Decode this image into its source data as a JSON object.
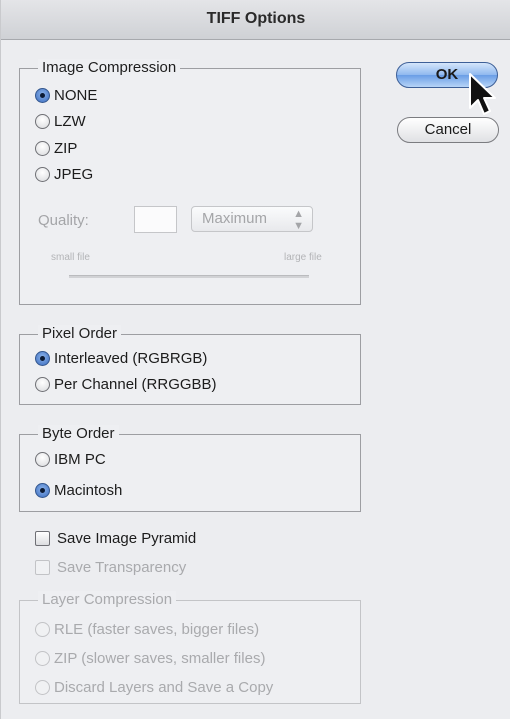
{
  "dialog": {
    "title": "TIFF Options"
  },
  "buttons": {
    "ok": "OK",
    "cancel": "Cancel"
  },
  "image_compression": {
    "label": "Image Compression",
    "options": [
      "NONE",
      "LZW",
      "ZIP",
      "JPEG"
    ],
    "selected": "NONE",
    "quality": {
      "label": "Quality:",
      "value": "",
      "select_value": "Maximum",
      "small_label": "small file",
      "large_label": "large file"
    }
  },
  "pixel_order": {
    "label": "Pixel Order",
    "options": [
      "Interleaved (RGBRGB)",
      "Per Channel (RRGGBB)"
    ],
    "selected": "Interleaved (RGBRGB)"
  },
  "byte_order": {
    "label": "Byte Order",
    "options": [
      "IBM PC",
      "Macintosh"
    ],
    "selected": "Macintosh"
  },
  "checkboxes": {
    "save_image_pyramid": {
      "label": "Save Image Pyramid",
      "checked": false
    },
    "save_transparency": {
      "label": "Save Transparency",
      "checked": false,
      "enabled": false
    }
  },
  "layer_compression": {
    "label": "Layer Compression",
    "enabled": false,
    "options": [
      "RLE (faster saves, bigger files)",
      "ZIP (slower saves, smaller files)",
      "Discard Layers and Save a Copy"
    ]
  },
  "colors": {
    "accent": "#3a6cc0",
    "dialog_bg": "#ecedf0",
    "disabled_text": "#a9aaad"
  }
}
